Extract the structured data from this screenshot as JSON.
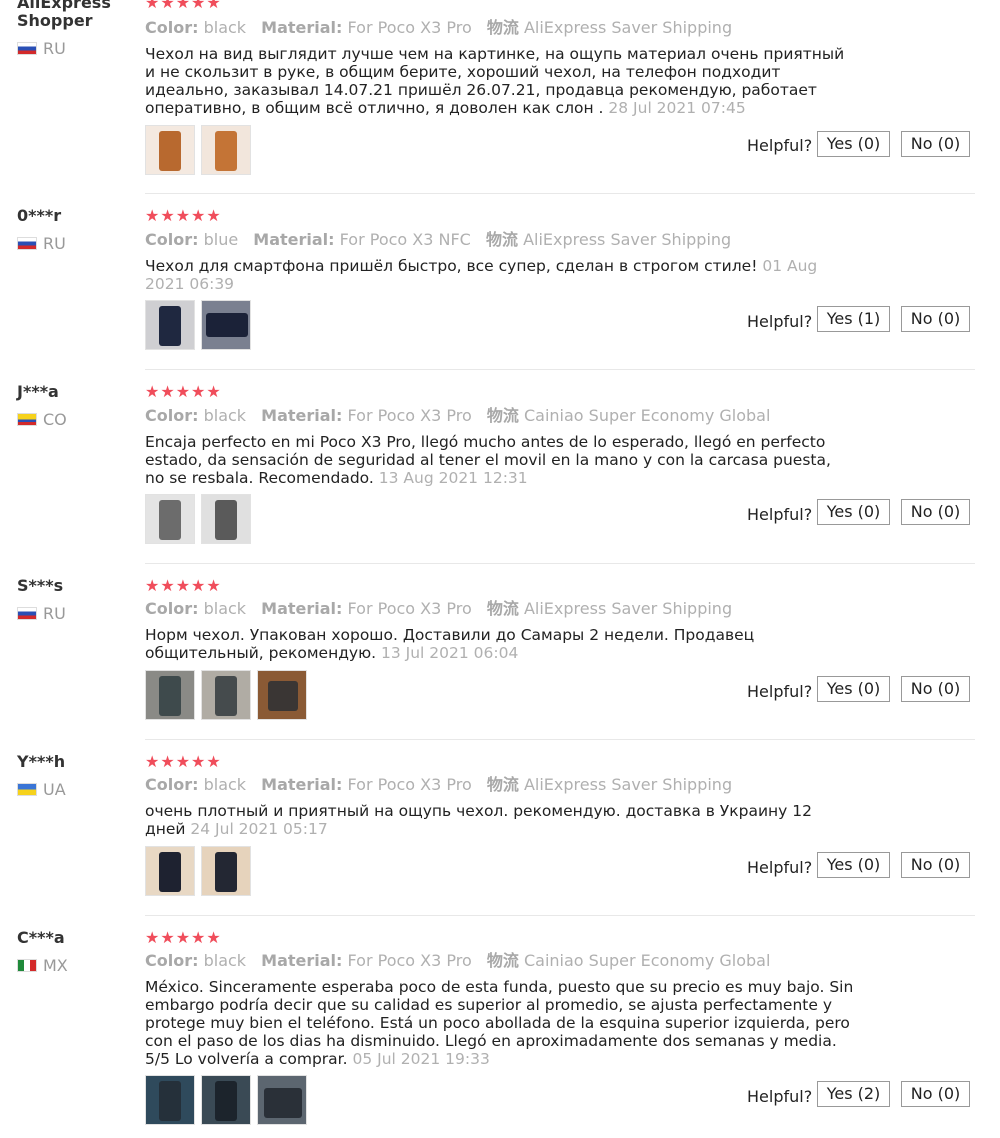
{
  "labels": {
    "color": "Color:",
    "material": "Material:",
    "shipping": "物流",
    "helpful": "Helpful?",
    "yes": "Yes",
    "no": "No"
  },
  "colors": {
    "star": "#f04d5b",
    "muted": "#b0b0b0"
  },
  "reviews": [
    {
      "name": "AliExpress Shopper",
      "country": "RU",
      "flag": "flag-ru-icon",
      "stars": "★★★★★",
      "color": "black",
      "material": "For Poco X3 Pro",
      "shipping": "AliExpress Saver Shipping",
      "text": "Чехол на вид выглядит лучше чем на картинке, на ощупь материал очень приятный и не скользит в руке, в общим берите, хороший чехол, на телефон подходит идеально, заказывал 14.07.21 пришёл 26.07.21, продавца рекомендую, работает оперативно, в общим всё отлично, я доволен как слон .",
      "date": "28 Jul 2021 07:45",
      "yes": "Yes (0)",
      "no": "No (0)",
      "photos": [
        "case-photo",
        "case-photo"
      ]
    },
    {
      "name": "0***r",
      "country": "RU",
      "flag": "flag-ru-icon",
      "stars": "★★★★★",
      "color": "blue",
      "material": "For Poco X3 NFC",
      "shipping": "AliExpress Saver Shipping",
      "text": "Чехол для смартфона пришёл быстро, все супер, сделан в строгом стиле!",
      "date": "01 Aug 2021 06:39",
      "yes": "Yes (1)",
      "no": "No (0)",
      "photos": [
        "case-photo",
        "case-photo"
      ]
    },
    {
      "name": "J***a",
      "country": "CO",
      "flag": "flag-co-icon",
      "stars": "★★★★★",
      "color": "black",
      "material": "For Poco X3 Pro",
      "shipping": "Cainiao Super Economy Global",
      "text": "Encaja perfecto en mi Poco X3 Pro, llegó mucho antes de lo esperado, llegó en perfecto estado, da sensación de seguridad al tener el movil en la mano y con la carcasa puesta, no se resbala. Recomendado.",
      "date": "13 Aug 2021 12:31",
      "yes": "Yes (0)",
      "no": "No (0)",
      "photos": [
        "case-photo",
        "case-photo"
      ]
    },
    {
      "name": "S***s",
      "country": "RU",
      "flag": "flag-ru-icon",
      "stars": "★★★★★",
      "color": "black",
      "material": "For Poco X3 Pro",
      "shipping": "AliExpress Saver Shipping",
      "text": "Норм чехол. Упакован хорошо. Доставили до Самары 2 недели. Продавец общительный, рекомендую.",
      "date": "13 Jul 2021 06:04",
      "yes": "Yes (0)",
      "no": "No (0)",
      "photos": [
        "case-photo",
        "case-photo",
        "case-photo"
      ]
    },
    {
      "name": "Y***h",
      "country": "UA",
      "flag": "flag-ua-icon",
      "stars": "★★★★★",
      "color": "black",
      "material": "For Poco X3 Pro",
      "shipping": "AliExpress Saver Shipping",
      "text": "очень плотный и приятный на ощупь чехол. рекомендую. доставка в Украину 12 дней",
      "date": "24 Jul 2021 05:17",
      "yes": "Yes (0)",
      "no": "No (0)",
      "photos": [
        "case-photo",
        "case-photo"
      ]
    },
    {
      "name": "C***a",
      "country": "MX",
      "flag": "flag-mx-icon",
      "stars": "★★★★★",
      "color": "black",
      "material": "For Poco X3 Pro",
      "shipping": "Cainiao Super Economy Global",
      "text": "México. Sinceramente esperaba poco de esta funda, puesto que su precio es muy bajo. Sin embargo podría decir que su calidad es superior al promedio, se ajusta perfectamente y protege muy bien el teléfono. Está un poco abollada de la esquina superior izquierda, pero con el paso de los dias ha disminuido. Llegó en aproximadamente dos semanas y media. 5/5 Lo volvería a comprar.",
      "date": "05 Jul 2021 19:33",
      "yes": "Yes (2)",
      "no": "No (0)",
      "photos": [
        "case-photo",
        "case-photo",
        "case-photo"
      ]
    }
  ]
}
